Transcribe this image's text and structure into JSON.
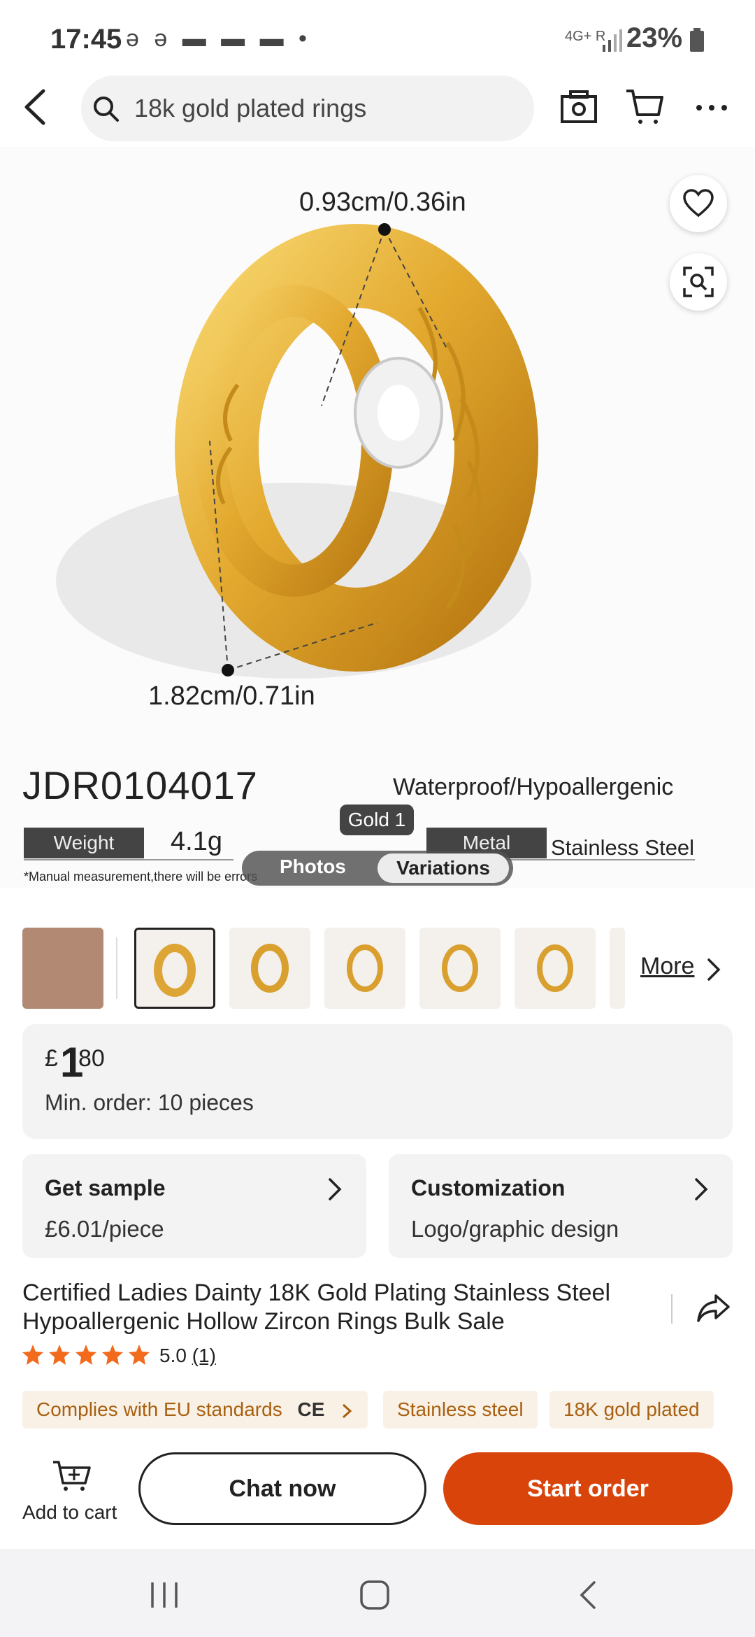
{
  "status_bar": {
    "time": "17:45",
    "notification_icons": "ə ə ▬ ▬ ▬ •",
    "network": "4G+",
    "network_roaming": "R",
    "battery": "23%"
  },
  "header": {
    "search_value": "18k gold plated rings"
  },
  "product_image": {
    "dimension_top": "0.93cm/0.36in",
    "dimension_bottom": "1.82cm/0.71in",
    "product_code": "JDR0104017",
    "feature_text": "Waterproof/Hypoallergenic",
    "weight_label": "Weight",
    "weight_value": "4.1g",
    "metal_label": "Metal",
    "metal_value": "Stainless Steel",
    "note": "*Manual measurement,there will be errors",
    "variant_tag": "Gold 1",
    "toggle_photos": "Photos",
    "toggle_variations": "Variations"
  },
  "thumbnails": {
    "more_label": "More",
    "count": 7,
    "selected_index": 1
  },
  "price": {
    "currency": "£",
    "integer": "1",
    "decimal": "80",
    "min_order": "Min. order: 10 pieces"
  },
  "sample": {
    "title": "Get sample",
    "price": "£6.01/piece"
  },
  "customization": {
    "title": "Customization",
    "detail": "Logo/graphic design"
  },
  "product": {
    "title_line1": "Certified Ladies Dainty 18K Gold Plating Stainless Steel",
    "title_line2": "Hypoallergenic Hollow Zircon Rings Bulk Sale",
    "rating": "5.0",
    "review_count": "(1)",
    "stars": 5
  },
  "tags": {
    "eu": "Complies with EU standards",
    "ce_mark": "CE",
    "steel": "Stainless steel",
    "gold": "18K gold plated"
  },
  "actions": {
    "add_to_cart": "Add to cart",
    "chat_now": "Chat now",
    "start_order": "Start order"
  },
  "colors": {
    "accent": "#d9440b",
    "tag_text": "#a86010",
    "tag_bg": "#faf1e6",
    "star": "#f26a1b"
  }
}
